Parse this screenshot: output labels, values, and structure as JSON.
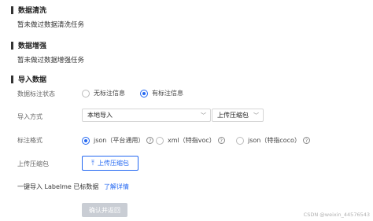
{
  "sections": {
    "clean": {
      "title": "数据清洗",
      "text": "暂未做过数据清洗任务"
    },
    "augment": {
      "title": "数据增强",
      "text": "暂未做过数据增强任务"
    },
    "import": {
      "title": "导入数据"
    }
  },
  "form": {
    "annotation_status": {
      "label": "数据标注状态",
      "options": [
        "无标注信息",
        "有标注信息"
      ],
      "selected": "有标注信息"
    },
    "import_method": {
      "label": "导入方式",
      "source_value": "本地导入",
      "type_value": "上传压缩包"
    },
    "annotation_format": {
      "label": "标注格式",
      "options": [
        "json（平台通用）",
        "xml（特指voc）",
        "json（特指coco）"
      ],
      "selected": "json（平台通用）",
      "help_icon": "?"
    },
    "upload": {
      "label": "上传压缩包",
      "button_label": "上传压缩包",
      "icon": "upload-icon"
    },
    "import_tip": {
      "text": "一键导入 Labelme 已标数据",
      "link": "了解详情"
    },
    "confirm_label": "确认并返回"
  },
  "watermark": "CSDN @weixin_44576543",
  "colors": {
    "accent": "#2468f2",
    "disabled": "#c9cdd4"
  },
  "icons": {
    "chevron": "chevron-down-icon",
    "help": "question-circle-icon",
    "upload": "upload-icon"
  }
}
